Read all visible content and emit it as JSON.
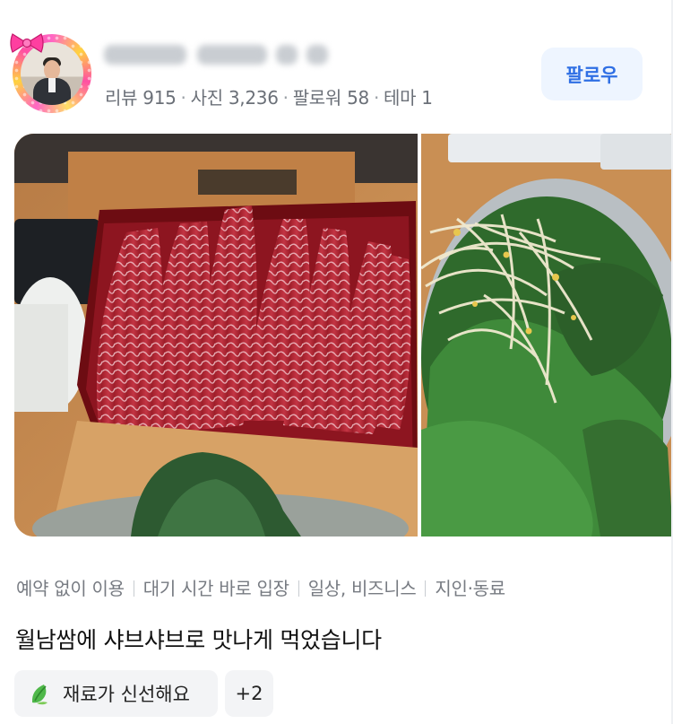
{
  "profile": {
    "stats": [
      {
        "label": "리뷰",
        "value": "915"
      },
      {
        "label": "사진",
        "value": "3,236"
      },
      {
        "label": "팔로워",
        "value": "58"
      },
      {
        "label": "테마",
        "value": "1"
      }
    ]
  },
  "actions": {
    "follow_label": "팔로우"
  },
  "photos": [
    {
      "icon": "sliced-beef-photo"
    },
    {
      "icon": "bean-sprouts-greens-photo"
    }
  ],
  "visit_info": [
    "예약 없이 이용",
    "대기 시간 바로 입장",
    "일상, 비즈니스",
    "지인·동료"
  ],
  "review": {
    "text": "월남쌈에 샤브샤브로 맛나게 먹었습니다"
  },
  "keywords": {
    "first_label": "재료가 신선해요",
    "first_icon": "leaf-icon",
    "more_label": "+2"
  },
  "colors": {
    "accent": "#2f6fe4",
    "button_bg": "#eef5ff",
    "muted_text": "#777b82",
    "chip_bg": "#f3f4f6"
  }
}
